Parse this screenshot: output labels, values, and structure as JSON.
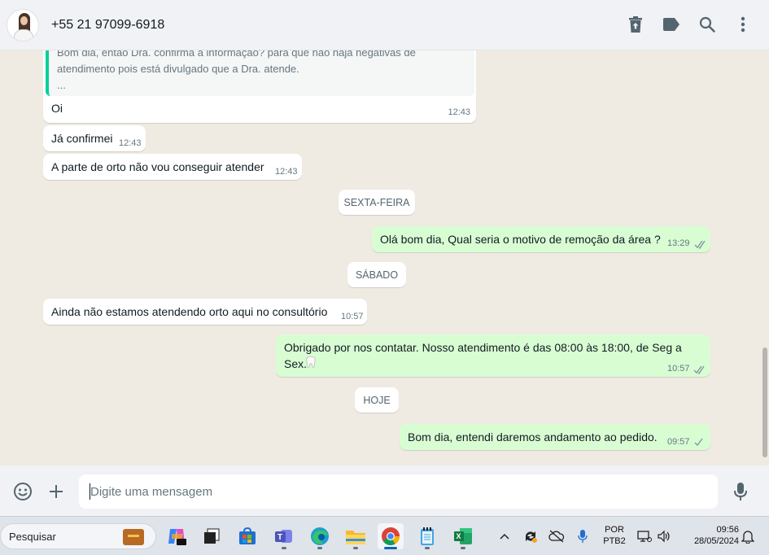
{
  "header": {
    "contact_name": "+55 21 97099-6918",
    "icons": [
      "archive-icon",
      "label-icon",
      "search-icon",
      "menu-icon"
    ]
  },
  "quoted": {
    "line1": "Bom dia, então Dra. confirma a informação? para que não haja negativas de",
    "line2": "atendimento pois está divulgado que a Dra. atende.",
    "line3": "..."
  },
  "messages": [
    {
      "text": "Oi",
      "time": "12:43",
      "direction": "in"
    },
    {
      "text": "Já confirmei",
      "time": "12:43",
      "direction": "in"
    },
    {
      "text": "A parte de orto não vou conseguir atender",
      "time": "12:43",
      "direction": "in"
    },
    {
      "text": "Olá bom dia, Qual seria o motivo de remoção da área ?",
      "time": "13:29",
      "direction": "out"
    },
    {
      "text": "Ainda não estamos atendendo orto aqui no consultório",
      "time": "10:57",
      "direction": "in"
    },
    {
      "text": "Obrigado por nos contatar. Nosso atendimento é das 08:00 às 18:00, de Seg a Sex.",
      "time": "10:57",
      "direction": "out"
    },
    {
      "text": "Bom dia, entendi daremos andamento ao pedido.",
      "time": "09:57",
      "direction": "out"
    }
  ],
  "day_separators": [
    "SEXTA-FEIRA",
    "SÁBADO",
    "HOJE"
  ],
  "composer": {
    "placeholder": "Digite uma mensagem"
  },
  "taskbar": {
    "search_label": "Pesquisar",
    "language": "POR",
    "layout": "PTB2",
    "time": "09:56",
    "date": "28/05/2024"
  },
  "colors": {
    "outgoing_bubble": "#d9fdd3",
    "incoming_bubble": "#ffffff",
    "chat_background": "#efeae2",
    "quote_accent": "#06cf9c"
  }
}
